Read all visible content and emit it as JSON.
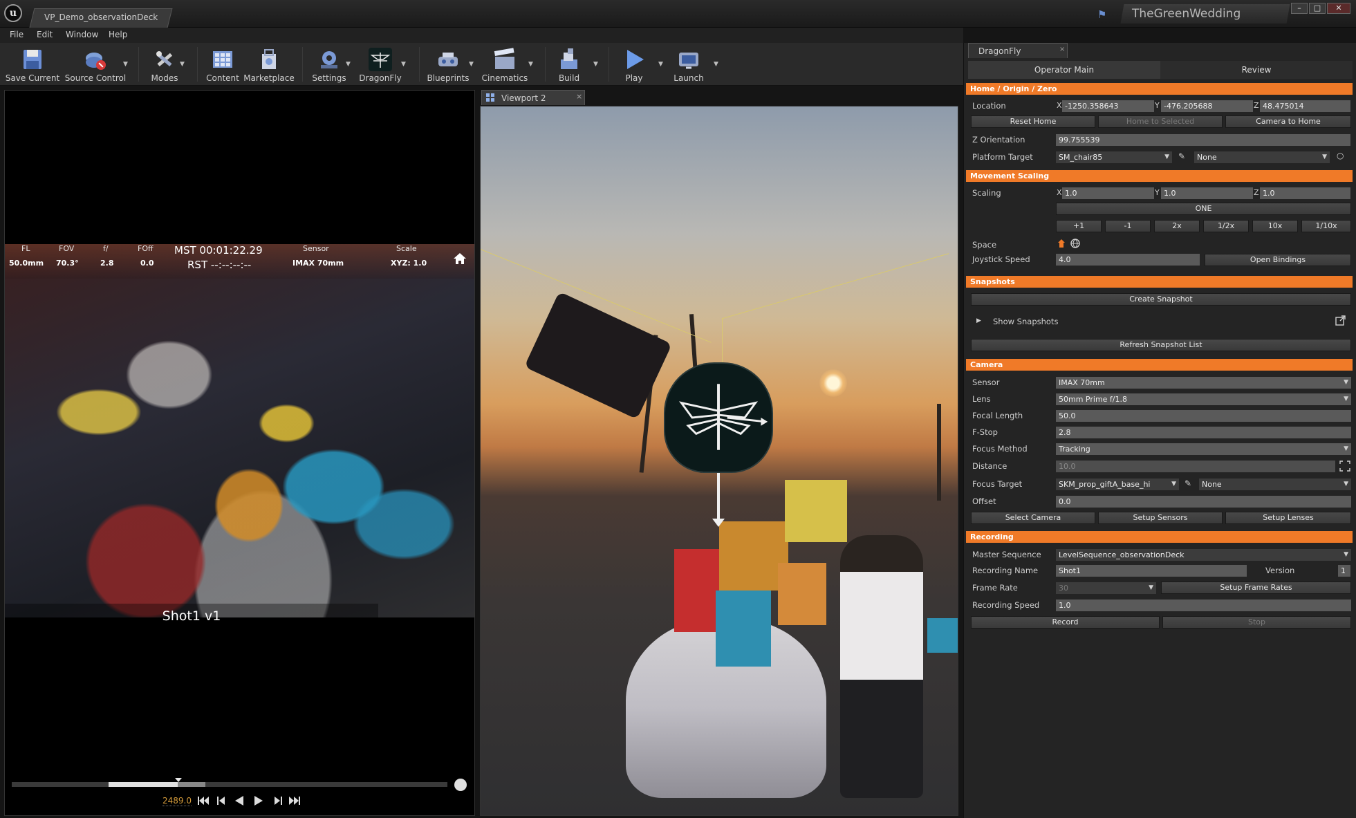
{
  "window": {
    "document_tab": "VP_Demo_observationDeck",
    "project_name": "TheGreenWedding",
    "controls": {
      "minimize": "–",
      "maximize": "□",
      "close": "✕"
    }
  },
  "menu": [
    "File",
    "Edit",
    "Window",
    "Help"
  ],
  "toolbar": {
    "save_current": "Save Current",
    "source_control": "Source Control",
    "modes": "Modes",
    "content": "Content",
    "marketplace": "Marketplace",
    "settings": "Settings",
    "dragonfly": "DragonFly",
    "blueprints": "Blueprints",
    "cinematics": "Cinematics",
    "build": "Build",
    "play": "Play",
    "launch": "Launch"
  },
  "left_viewport": {
    "hud": {
      "fl_label": "FL",
      "fl_value": "50.0mm",
      "fov_label": "FOV",
      "fov_value": "70.3°",
      "f_label": "f/",
      "f_value": "2.8",
      "foff_label": "FOff",
      "foff_value": "0.0",
      "mst": "MST 00:01:22.29",
      "rst": "RST --:--:--:--",
      "sensor_label": "Sensor",
      "sensor_value": "IMAX 70mm",
      "scale_label": "Scale",
      "scale_value": "XYZ: 1.0"
    },
    "shot_label": "Shot1 v1",
    "frame_number": "2489.0"
  },
  "viewport2": {
    "tab_label": "Viewport 2",
    "close": "×"
  },
  "panel": {
    "tab_label": "DragonFly",
    "tab_close": "×",
    "subtabs": [
      "Operator Main",
      "Review"
    ],
    "home": {
      "header": "Home / Origin / Zero",
      "location_label": "Location",
      "x_axis": "X",
      "x": "-1250.358643",
      "y_axis": "Y",
      "y": "-476.205688",
      "z_axis": "Z",
      "z": "48.475014",
      "reset_home": "Reset Home",
      "home_to_selected": "Home to Selected",
      "camera_to_home": "Camera to Home",
      "z_orientation_label": "Z Orientation",
      "z_orientation": "99.755539",
      "platform_target_label": "Platform Target",
      "platform_target": "SM_chair85",
      "platform_target_2": "None"
    },
    "movement": {
      "header": "Movement Scaling",
      "scaling_label": "Scaling",
      "x_axis": "X",
      "x": "1.0",
      "y_axis": "Y",
      "y": "1.0",
      "z_axis": "Z",
      "z": "1.0",
      "one": "ONE",
      "steps": [
        "+1",
        "-1",
        "2x",
        "1/2x",
        "10x",
        "1/10x"
      ],
      "space_label": "Space",
      "joystick_label": "Joystick Speed",
      "joystick_speed": "4.0",
      "open_bindings": "Open Bindings"
    },
    "snapshots": {
      "header": "Snapshots",
      "create": "Create Snapshot",
      "show": "Show Snapshots",
      "refresh": "Refresh Snapshot List"
    },
    "camera": {
      "header": "Camera",
      "sensor_label": "Sensor",
      "sensor": "IMAX 70mm",
      "lens_label": "Lens",
      "lens": "50mm Prime f/1.8",
      "focal_label": "Focal Length",
      "focal": "50.0",
      "fstop_label": "F-Stop",
      "fstop": "2.8",
      "focus_method_label": "Focus Method",
      "focus_method": "Tracking",
      "distance_label": "Distance",
      "distance": "10.0",
      "focus_target_label": "Focus Target",
      "focus_target": "SKM_prop_giftA_base_hi",
      "focus_target_2": "None",
      "offset_label": "Offset",
      "offset": "0.0",
      "select_camera": "Select Camera",
      "setup_sensors": "Setup Sensors",
      "setup_lenses": "Setup Lenses"
    },
    "recording": {
      "header": "Recording",
      "master_label": "Master Sequence",
      "master": "LevelSequence_observationDeck",
      "name_label": "Recording Name",
      "name": "Shot1",
      "version_label": "Version",
      "version": "1",
      "frame_rate_label": "Frame Rate",
      "frame_rate": "30",
      "setup_frame_rates": "Setup Frame Rates",
      "speed_label": "Recording Speed",
      "speed": "1.0",
      "record": "Record",
      "stop": "Stop"
    }
  },
  "colors": {
    "section_header": "#f07a28",
    "panel_bg": "#242424",
    "field_bg": "#5a5a5a",
    "accent_blue": "#6a8fd0"
  }
}
